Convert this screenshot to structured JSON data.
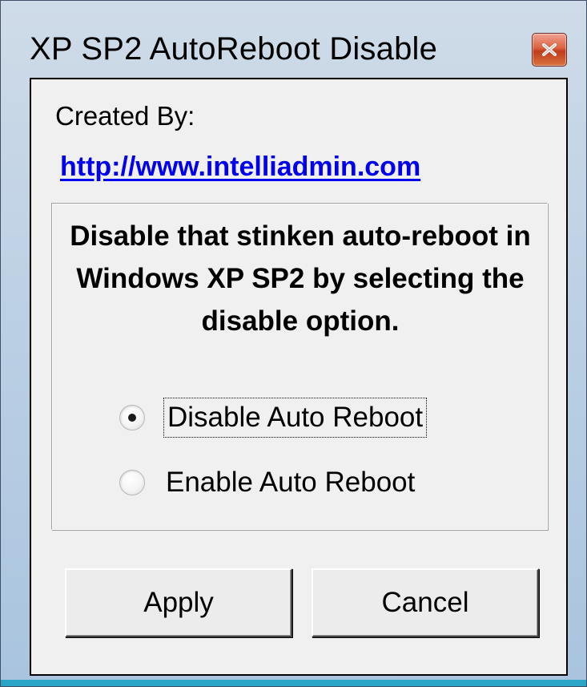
{
  "window": {
    "title": "XP SP2 AutoReboot Disable",
    "close_label": "x",
    "accent_colors": {
      "frame": "#bcd0e4",
      "close_button": "#c03c1c",
      "link": "#0000ee",
      "bottom_strip": "#2aa5c8"
    }
  },
  "header": {
    "created_by_label": "Created By:",
    "link_text": "http://www.intelliadmin.com"
  },
  "group": {
    "description": "Disable that stinken auto-reboot in Windows XP SP2 by selecting the disable option.",
    "options": [
      {
        "label": "Disable Auto Reboot",
        "selected": true,
        "focused": true
      },
      {
        "label": "Enable Auto Reboot",
        "selected": false,
        "focused": false
      }
    ]
  },
  "buttons": {
    "apply_label": "Apply",
    "cancel_label": "Cancel"
  }
}
